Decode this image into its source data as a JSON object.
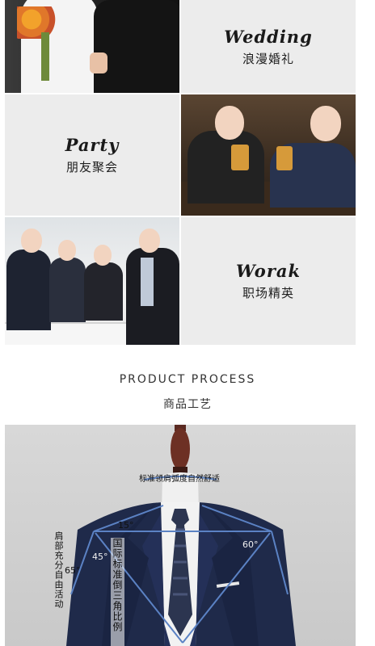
{
  "scenes": [
    {
      "title": "Wedding",
      "subtitle": "浪漫婚礼"
    },
    {
      "title": "Party",
      "subtitle": "朋友聚会"
    },
    {
      "title": "Worak",
      "subtitle": "职场精英"
    }
  ],
  "process": {
    "title_en": "PRODUCT PROCESS",
    "title_cn": "商品工艺",
    "annotations": {
      "shoulder_top": "标准领肩弧度自然舒适",
      "shoulder_side": "肩部充分自由活动",
      "triangle": "国际标准倒三角比例",
      "angle_15": "15°",
      "angle_45": "45°",
      "angle_60": "60°",
      "angle_65": "65°"
    }
  },
  "colors": {
    "label_bg": "#ececec",
    "suit_navy": "#1f2a4a",
    "guide_line": "#5b82c4"
  }
}
